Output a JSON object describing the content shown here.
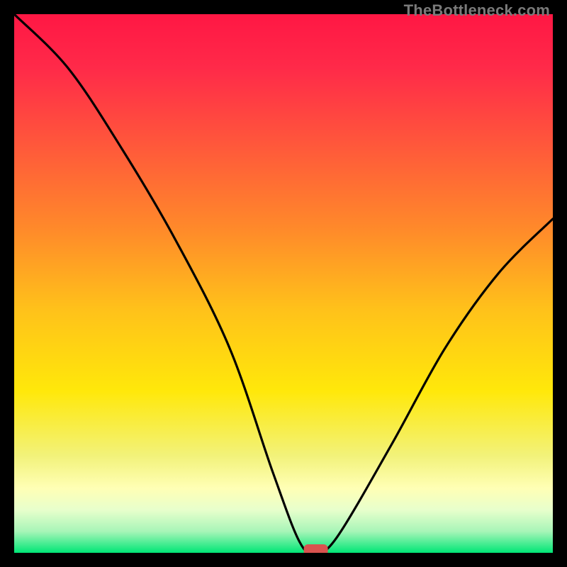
{
  "attribution": "TheBottleneck.com",
  "chart_data": {
    "type": "line",
    "title": "",
    "xlabel": "",
    "ylabel": "",
    "xlim": [
      0,
      100
    ],
    "ylim": [
      0,
      100
    ],
    "x": [
      0,
      10,
      20,
      30,
      40,
      48,
      53,
      56,
      60,
      70,
      80,
      90,
      100
    ],
    "values": [
      100,
      90,
      75,
      58,
      38,
      15,
      2,
      0,
      3,
      20,
      38,
      52,
      62
    ],
    "marker": {
      "x": 56,
      "y": 0
    },
    "background_gradient": {
      "stops": [
        {
          "offset": 0.0,
          "color": "#ff1744"
        },
        {
          "offset": 0.1,
          "color": "#ff2a49"
        },
        {
          "offset": 0.25,
          "color": "#ff5a3a"
        },
        {
          "offset": 0.4,
          "color": "#ff8a2a"
        },
        {
          "offset": 0.55,
          "color": "#ffc21a"
        },
        {
          "offset": 0.7,
          "color": "#ffe80a"
        },
        {
          "offset": 0.82,
          "color": "#f2f27a"
        },
        {
          "offset": 0.88,
          "color": "#ffffb5"
        },
        {
          "offset": 0.92,
          "color": "#e8ffcc"
        },
        {
          "offset": 0.96,
          "color": "#a8f5b8"
        },
        {
          "offset": 1.0,
          "color": "#00e676"
        }
      ]
    }
  }
}
